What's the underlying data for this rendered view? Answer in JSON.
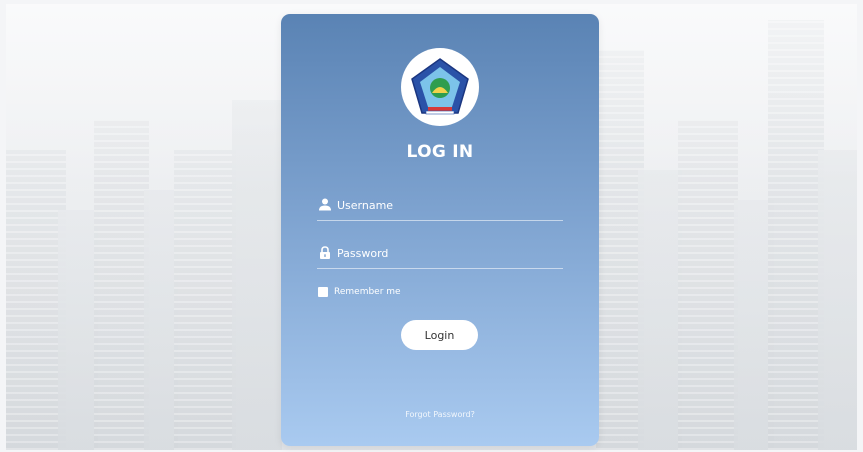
{
  "login": {
    "title": "LOG IN",
    "username": {
      "value": "",
      "placeholder": "Username",
      "icon": "user-icon"
    },
    "password": {
      "value": "",
      "placeholder": "Password",
      "icon": "lock-icon"
    },
    "remember_label": "Remember me",
    "login_label": "Login",
    "forgot_label": "Forgot Password?"
  },
  "logo": {
    "icon": "school-emblem-logo"
  },
  "colors": {
    "card_top": "#5a83b4",
    "card_bottom": "#a9caf0",
    "text": "#ffffff",
    "button_bg": "#ffffff",
    "button_text": "#333333"
  }
}
